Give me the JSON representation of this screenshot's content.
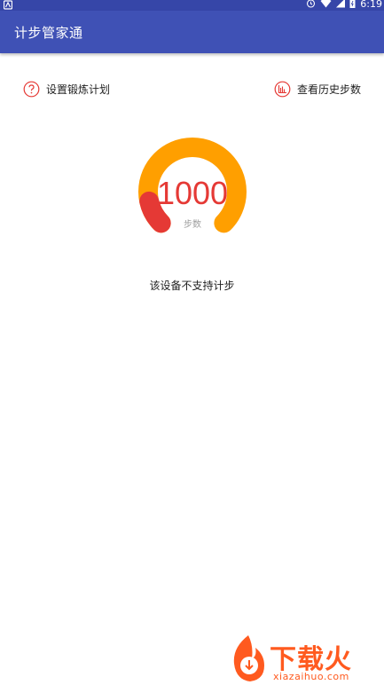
{
  "status_bar": {
    "time": "6:19",
    "icons": [
      "notification-icon",
      "alarm-icon",
      "wifi-icon",
      "signal-icon",
      "battery-icon"
    ]
  },
  "app_bar": {
    "title": "计步管家通",
    "background": "#3f51b5"
  },
  "actions": {
    "left": {
      "label": "设置锻炼计划",
      "icon": "question-circle-icon"
    },
    "right": {
      "label": "查看历史步数",
      "icon": "bar-chart-icon"
    }
  },
  "gauge": {
    "value": "1000",
    "unit": "步数",
    "progress_fraction": 0.12,
    "track_color": "#ff9f00",
    "progress_color": "#e53935"
  },
  "message": "该设备不支持计步",
  "watermark": {
    "text": "下载火",
    "subtext": "xiazaihuo.com",
    "color": "#ff5a1f"
  }
}
